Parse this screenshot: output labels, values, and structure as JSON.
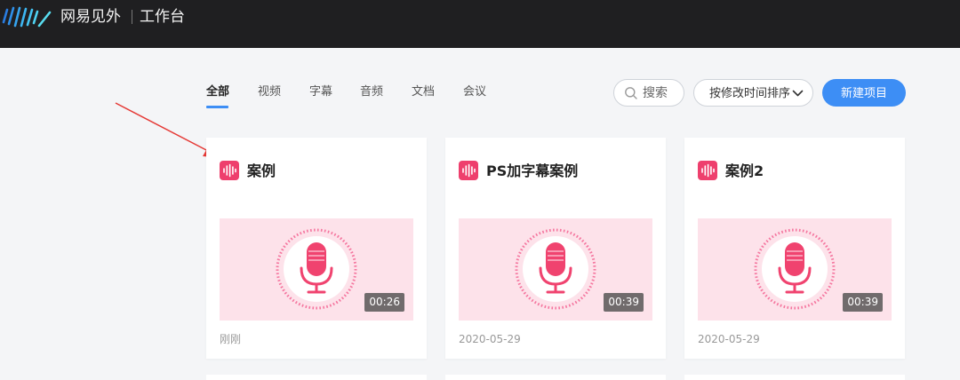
{
  "header": {
    "brand": "网易见外",
    "workspace": "工作台",
    "logo_icon": "waveform-logo-icon"
  },
  "tabs": [
    {
      "label": "全部",
      "active": true
    },
    {
      "label": "视频",
      "active": false
    },
    {
      "label": "字幕",
      "active": false
    },
    {
      "label": "音频",
      "active": false
    },
    {
      "label": "文档",
      "active": false
    },
    {
      "label": "会议",
      "active": false
    }
  ],
  "toolbar": {
    "search_label": "搜索",
    "sort_label": "按修改时间排序",
    "new_project_label": "新建项目"
  },
  "projects": [
    {
      "title": "案例",
      "duration": "00:26",
      "date": "刚刚",
      "type_icon": "audio-wave-icon"
    },
    {
      "title": "PS加字幕案例",
      "duration": "00:39",
      "date": "2020-05-29",
      "type_icon": "audio-wave-icon"
    },
    {
      "title": "案例2",
      "duration": "00:39",
      "date": "2020-05-29",
      "type_icon": "audio-wave-icon"
    }
  ],
  "colors": {
    "accent": "#3d8ef5",
    "topbar": "#1f1f21",
    "audio_icon": "#ee3f6d",
    "thumb_bg": "#fde2ea",
    "annotation_arrow": "#e53935"
  }
}
